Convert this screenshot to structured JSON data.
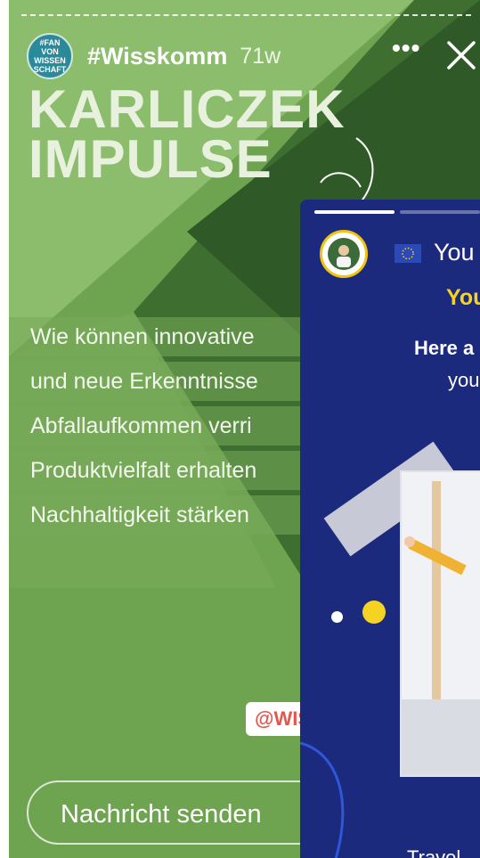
{
  "story": {
    "account": "#Wisskomm",
    "age": "71w",
    "avatar_text": "#FAN VON WISSEN SCHAFT",
    "headline": [
      "KARLICZEK",
      "IMPULSE"
    ],
    "lines": [
      "Wie können innovative",
      "und neue Erkenntnisse",
      "Abfallaufkommen verri",
      "Produktvielfalt erhalten",
      "Nachhaltigkeit stärken"
    ],
    "handle": "@WIS",
    "reply_placeholder": "Nachricht senden",
    "more_icon": "more-options-icon",
    "close_icon": "close-icon",
    "colors": {
      "green_light": "#7fb05f",
      "green_dark": "#2f5a2a",
      "green_mid": "#4f8a3c"
    }
  },
  "second_story": {
    "title": "You",
    "yellow_text": "You",
    "bold_text": "Here a",
    "white_text": "you",
    "caption": "Travel",
    "colors": {
      "background": "#1b2a7d",
      "accent": "#f4d322"
    }
  }
}
